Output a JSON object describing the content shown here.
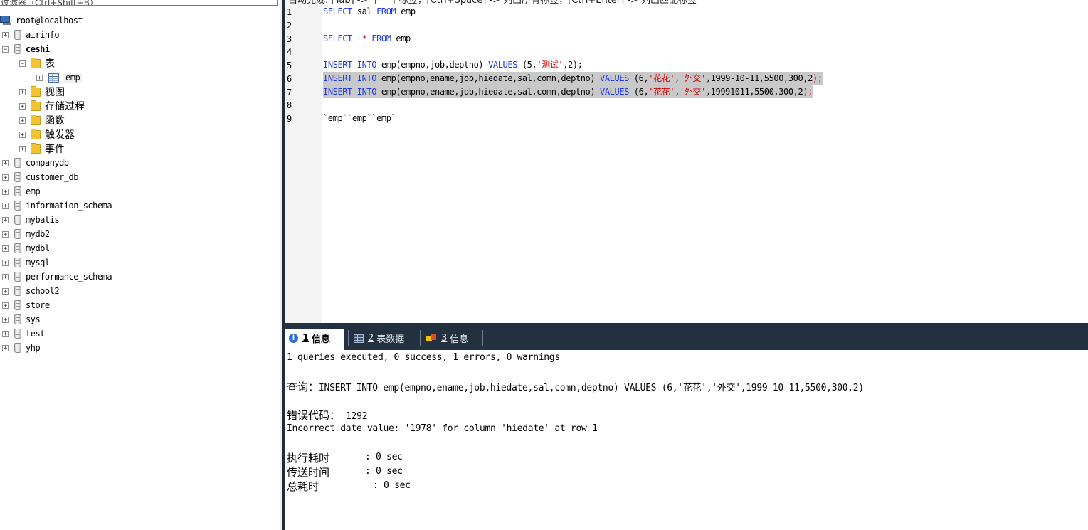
{
  "object_browser": {
    "filter_placeholder": "过滤器（Ctrl+Shift+B）",
    "host": "root@localhost",
    "items": [
      {
        "id": "airinfo",
        "label": "airinfo",
        "type": "database",
        "expander": "+"
      },
      {
        "id": "ceshi",
        "label": "ceshi",
        "type": "database",
        "expander": "−",
        "bold": true
      },
      {
        "id": "tables",
        "label": "表",
        "type": "folder",
        "expander": "−"
      },
      {
        "id": "emp-table",
        "label": "emp",
        "type": "table",
        "expander": "+"
      },
      {
        "id": "views",
        "label": "视图",
        "type": "folder",
        "expander": "+"
      },
      {
        "id": "procs",
        "label": "存储过程",
        "type": "folder",
        "expander": "+"
      },
      {
        "id": "funcs",
        "label": "函数",
        "type": "folder",
        "expander": "+"
      },
      {
        "id": "triggers",
        "label": "触发器",
        "type": "folder",
        "expander": "+"
      },
      {
        "id": "events",
        "label": "事件",
        "type": "folder",
        "expander": "+"
      },
      {
        "id": "companydb",
        "label": "companydb",
        "type": "database",
        "expander": "+"
      },
      {
        "id": "customer_db",
        "label": "customer_db",
        "type": "database",
        "expander": "+"
      },
      {
        "id": "emp",
        "label": "emp",
        "type": "database",
        "expander": "+"
      },
      {
        "id": "information_schema",
        "label": "information_schema",
        "type": "database",
        "expander": "+"
      },
      {
        "id": "mybatis",
        "label": "mybatis",
        "type": "database",
        "expander": "+"
      },
      {
        "id": "mydb2",
        "label": "mydb2",
        "type": "database",
        "expander": "+"
      },
      {
        "id": "mydbl",
        "label": "mydbl",
        "type": "database",
        "expander": "+"
      },
      {
        "id": "mysql",
        "label": "mysql",
        "type": "database",
        "expander": "+"
      },
      {
        "id": "performance_schema",
        "label": "performance_schema",
        "type": "database",
        "expander": "+"
      },
      {
        "id": "school2",
        "label": "school2",
        "type": "database",
        "expander": "+"
      },
      {
        "id": "store",
        "label": "store",
        "type": "database",
        "expander": "+"
      },
      {
        "id": "sys",
        "label": "sys",
        "type": "database",
        "expander": "+"
      },
      {
        "id": "test",
        "label": "test",
        "type": "database",
        "expander": "+"
      },
      {
        "id": "yhp",
        "label": "yhp",
        "type": "database",
        "expander": "+"
      }
    ]
  },
  "editor": {
    "shortcut_hint": "自动完成: [Tab] -> 下一个标签，[Ctrl+Space] -> 列出所有标签，[Ctrl+Enter] -> 列出匹配标签",
    "line_numbers": [
      "1",
      "2",
      "3",
      "4",
      "5",
      "6",
      "7",
      "8",
      "9"
    ],
    "lines": [
      [
        {
          "t": "SELECT",
          "c": "kw"
        },
        {
          "t": " sal ",
          "c": "fn"
        },
        {
          "t": "FROM",
          "c": "kw"
        },
        {
          "t": " emp",
          "c": "fn"
        }
      ],
      [],
      [
        {
          "t": "SELECT",
          "c": "kw"
        },
        {
          "t": "  ",
          "c": "fn"
        },
        {
          "t": "*",
          "c": "str"
        },
        {
          "t": " ",
          "c": "fn"
        },
        {
          "t": "FROM",
          "c": "kw"
        },
        {
          "t": " emp",
          "c": "fn"
        }
      ],
      [],
      [
        {
          "t": "INSERT",
          "c": "kw"
        },
        {
          "t": " ",
          "c": "fn"
        },
        {
          "t": "INTO",
          "c": "kw"
        },
        {
          "t": " emp(empno,job,deptno) ",
          "c": "fn"
        },
        {
          "t": "VALUES",
          "c": "kw"
        },
        {
          "t": " (5,",
          "c": "fn"
        },
        {
          "t": "'测试'",
          "c": "str"
        },
        {
          "t": ",2);",
          "c": "fn"
        }
      ],
      [
        {
          "t": "INSERT",
          "c": "kw"
        },
        {
          "t": " ",
          "c": "fn"
        },
        {
          "t": "INTO",
          "c": "kw"
        },
        {
          "t": " emp(empno,ename,job,hiedate,sal,comn,deptno) ",
          "c": "fn"
        },
        {
          "t": "VALUES",
          "c": "kw"
        },
        {
          "t": " (6,",
          "c": "fn"
        },
        {
          "t": "'花花'",
          "c": "str"
        },
        {
          "t": ",",
          "c": "fn"
        },
        {
          "t": "'外交'",
          "c": "str"
        },
        {
          "t": ",1999-10-11,5500,300,2",
          "c": "fn"
        },
        {
          "t": ");",
          "c": "str"
        }
      ],
      [
        {
          "t": "INSERT",
          "c": "kw"
        },
        {
          "t": " ",
          "c": "fn"
        },
        {
          "t": "INTO",
          "c": "kw"
        },
        {
          "t": " emp(empno,ename,job,hiedate,sal,comn,deptno) ",
          "c": "fn"
        },
        {
          "t": "VALUES",
          "c": "kw"
        },
        {
          "t": " (6,",
          "c": "fn"
        },
        {
          "t": "'花花'",
          "c": "str"
        },
        {
          "t": ",",
          "c": "fn"
        },
        {
          "t": "'外交'",
          "c": "str"
        },
        {
          "t": ",19991011,5500,300,2",
          "c": "fn"
        },
        {
          "t": ");",
          "c": "str"
        }
      ],
      [],
      [
        {
          "t": "`emp``emp``emp`",
          "c": "fn"
        }
      ]
    ]
  },
  "result_tabs": [
    {
      "num": "1",
      "label": "信息",
      "icon": "info-icon"
    },
    {
      "num": "2",
      "label": "表数据",
      "icon": "table-data-icon"
    },
    {
      "num": "3",
      "label": "信息",
      "icon": "message-icon"
    }
  ],
  "results": {
    "summary": "1 queries executed, 0 success, 1 errors, 0 warnings",
    "query_label": "查询：",
    "query": "INSERT INTO emp(empno,ename,job,hiedate,sal,comn,deptno) VALUES (6,'花花','外交',1999-10-11,5500,300,2)",
    "error_code_label": "错误代码：",
    "error_code": "1292",
    "error_message": "Incorrect date value: '1978' for column 'hiedate' at row 1",
    "exec_time_label": "执行耗时",
    "exec_time": ": 0 sec",
    "transfer_time_label": "传送时间",
    "transfer_time": ": 0 sec",
    "total_time_label": "总耗时",
    "total_time": ": 0 sec"
  }
}
